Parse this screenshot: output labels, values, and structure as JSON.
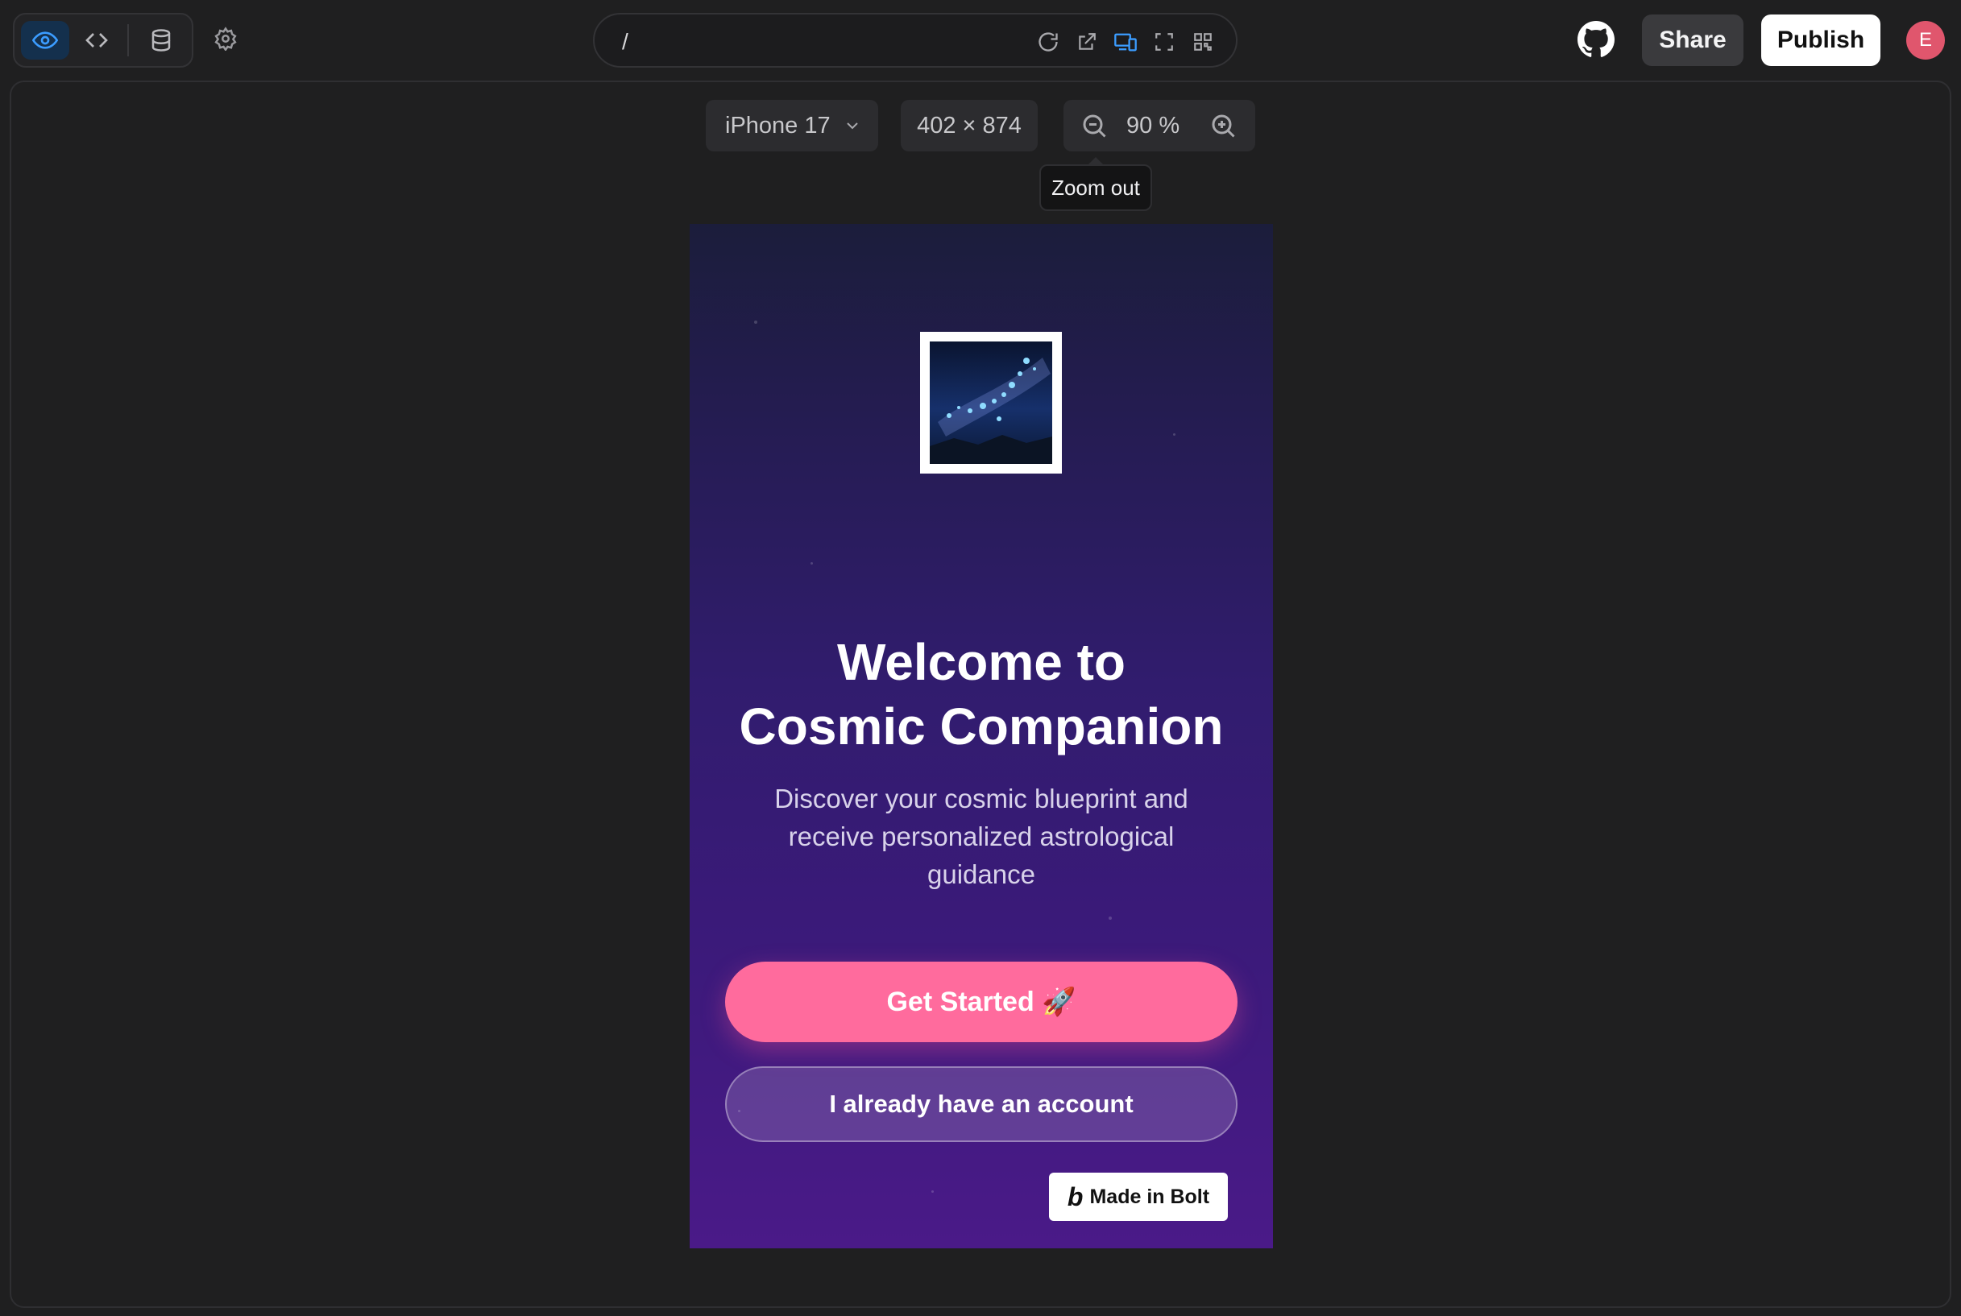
{
  "toolbar": {
    "modes": [
      {
        "icon": "eye-icon",
        "active": true
      },
      {
        "icon": "code-icon",
        "active": false
      },
      {
        "icon": "database-icon",
        "active": false
      }
    ],
    "settings_icon": "gear-icon",
    "url_path": "/",
    "url_tools": [
      "reload-icon",
      "open-external-icon",
      "device-toggle-icon",
      "fullscreen-icon",
      "qr-code-icon"
    ],
    "github_icon": "github-icon",
    "share_label": "Share",
    "publish_label": "Publish",
    "avatar_initial": "E"
  },
  "preview_controls": {
    "device_name": "iPhone 17",
    "device_size": "402 × 874",
    "zoom_value": "90 %",
    "tooltip": "Zoom out"
  },
  "app": {
    "title_line1": "Welcome to",
    "title_line2": "Cosmic Companion",
    "subtitle": "Discover your cosmic blueprint and receive personalized astrological guidance",
    "primary_button": "Get Started 🚀",
    "secondary_button": "I already have an account",
    "badge": "Made in Bolt",
    "badge_logo": "b"
  },
  "colors": {
    "accent_blue": "#3b9cff",
    "primary_pink": "#ff6b9d",
    "avatar_red": "#e0566d",
    "background": "#1f1f20"
  }
}
